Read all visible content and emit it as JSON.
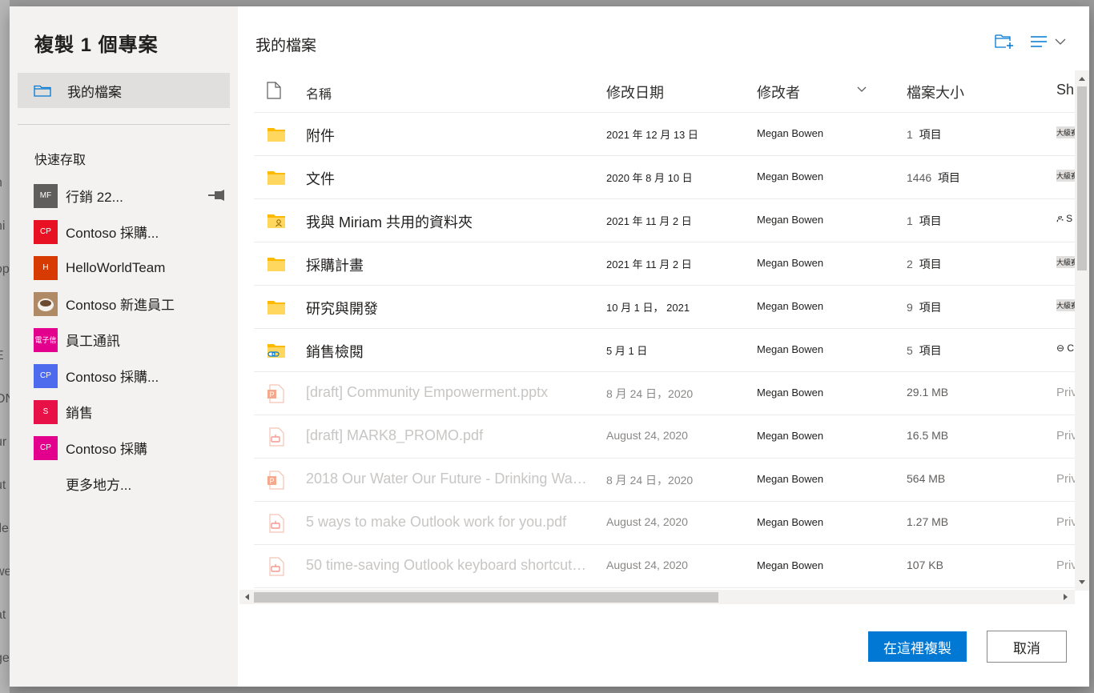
{
  "background": {
    "fragments": [
      "h",
      "ni",
      "op",
      "E",
      "ON",
      "ur",
      "ut",
      "tle",
      "we",
      "at",
      "ge"
    ]
  },
  "dialog": {
    "title": "複製 1 個專案",
    "nav_my_files": "我的檔案",
    "quick_access_title": "快速存取",
    "quick_access": [
      {
        "label": "行銷 22...",
        "initials": "MF",
        "color": "#605e5c",
        "icon": "pin-icon"
      },
      {
        "label": "Contoso 採購...",
        "initials": "CP",
        "color": "#e81123"
      },
      {
        "label": "HelloWorldTeam",
        "initials": "H",
        "color": "#d83b01"
      },
      {
        "label": "Contoso 新進員工",
        "initials": "",
        "color": "#c8a27a",
        "icon": "coffee-photo"
      },
      {
        "label": "員工通訊",
        "initials": "電子信",
        "color": "#e3008c"
      },
      {
        "label": "Contoso 採購...",
        "initials": "CP",
        "color": "#4f6bed"
      },
      {
        "label": "銷售",
        "initials": "S",
        "color": "#e81147"
      },
      {
        "label": "Contoso 採購",
        "initials": "CP",
        "color": "#e3008c"
      }
    ],
    "more_places": "更多地方...",
    "breadcrumb": "我的檔案",
    "columns": {
      "name": "名稱",
      "modified": "修改日期",
      "modified_by": "修改者",
      "size": "檔案大小",
      "sharing": "Sh"
    },
    "rows": [
      {
        "name": "附件",
        "modified": "2021 年 12 月 13 日",
        "by": "Megan Bowen",
        "size_num": "1",
        "size_unit": "項目",
        "sharing": "大級赛",
        "icon": "folder-icon"
      },
      {
        "name": "文件",
        "modified": "2020 年 8 月 10 日",
        "by": "Megan Bowen",
        "size_num": "1446",
        "size_unit": "項目",
        "sharing": "大級赛",
        "icon": "folder-icon"
      },
      {
        "name": "我與 Miriam 共用的資料夾",
        "modified": "2021 年 11 月 2 日",
        "by": "Megan Bowen",
        "size_num": "1",
        "size_unit": "項目",
        "sharing": "ዶ S",
        "icon": "shared-folder-icon"
      },
      {
        "name": "採購計畫",
        "modified": "2021 年 11 月 2 日",
        "by": "Megan Bowen",
        "size_num": "2",
        "size_unit": "項目",
        "sharing": "大級赛",
        "icon": "folder-icon"
      },
      {
        "name": "研究與開發",
        "modified": "10 月 1 日， 2021",
        "by": "Megan Bowen",
        "size_num": "9",
        "size_unit": "項目",
        "sharing": "大級赛",
        "icon": "folder-icon"
      },
      {
        "name": "銷售檢閱",
        "modified": "5 月 1 日",
        "by": "Megan Bowen",
        "size_num": "5",
        "size_unit": "項目",
        "sharing": "⊖ C",
        "icon": "link-folder-icon"
      },
      {
        "name": "[draft] Community Empowerment.pptx",
        "modified": "8 月 24 日，2020",
        "by": "Megan Bowen",
        "size_num": "29.1 MB",
        "size_unit": "",
        "sharing": "Priv",
        "icon": "pptx-icon"
      },
      {
        "name": "[draft] MARK8_PROMO.pdf",
        "modified": "August 24, 2020",
        "by": "Megan Bowen",
        "size_num": "16.5 MB",
        "size_unit": "",
        "sharing": "Priv",
        "icon": "pdf-icon"
      },
      {
        "name": "2018 Our Water Our Future - Drinking Wate...",
        "modified": "8 月 24 日，2020",
        "by": "Megan Bowen",
        "size_num": "564 MB",
        "size_unit": "",
        "sharing": "Priv",
        "icon": "pptx-icon"
      },
      {
        "name": "5 ways to make Outlook work for you.pdf",
        "modified": "August 24, 2020",
        "by": "Megan Bowen",
        "size_num": "1.27 MB",
        "size_unit": "",
        "sharing": "Priv",
        "icon": "pdf-icon"
      },
      {
        "name": "50 time-saving Outlook keyboard shortcuts...",
        "modified": "August 24, 2020",
        "by": "Megan Bowen",
        "size_num": "107 KB",
        "size_unit": "",
        "sharing": "Priv",
        "icon": "pdf-icon"
      }
    ],
    "primary_button": "在這裡複製",
    "cancel_button": "取消"
  }
}
